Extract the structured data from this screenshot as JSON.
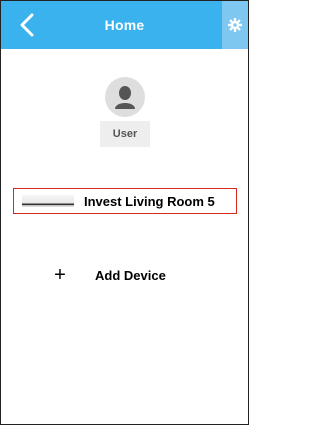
{
  "header": {
    "title": "Home",
    "back_icon": "chevron-left-icon",
    "settings_icon": "gear-icon",
    "background_color": "#39b2ee"
  },
  "user": {
    "label": "User",
    "avatar_icon": "user-silhouette-icon"
  },
  "devices": [
    {
      "name": "Invest Living Room 5",
      "selected": true
    }
  ],
  "add_device": {
    "label": "Add Device",
    "icon": "plus-icon"
  }
}
